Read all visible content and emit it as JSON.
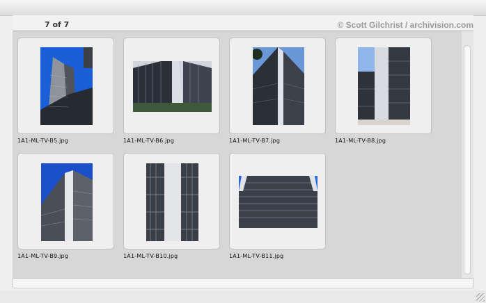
{
  "header": {
    "counter": "7 of 7",
    "credit": "© Scott Gilchrist / archivision.com"
  },
  "thumbnails": [
    {
      "filename": "1A1-ML-TV-B5.jpg"
    },
    {
      "filename": "1A1-ML-TV-B6.jpg"
    },
    {
      "filename": "1A1-ML-TV-B7.jpg"
    },
    {
      "filename": "1A1-ML-TV-B8.jpg"
    },
    {
      "filename": "1A1-ML-TV-B9.jpg"
    },
    {
      "filename": "1A1-ML-TV-B10.jpg"
    },
    {
      "filename": "1A1-ML-TV-B11.jpg"
    }
  ],
  "colors": {
    "sky": "#1b5fd8",
    "building": "#2e3440",
    "card_bg": "#efefef",
    "grid_bg": "#d7d7d7"
  }
}
